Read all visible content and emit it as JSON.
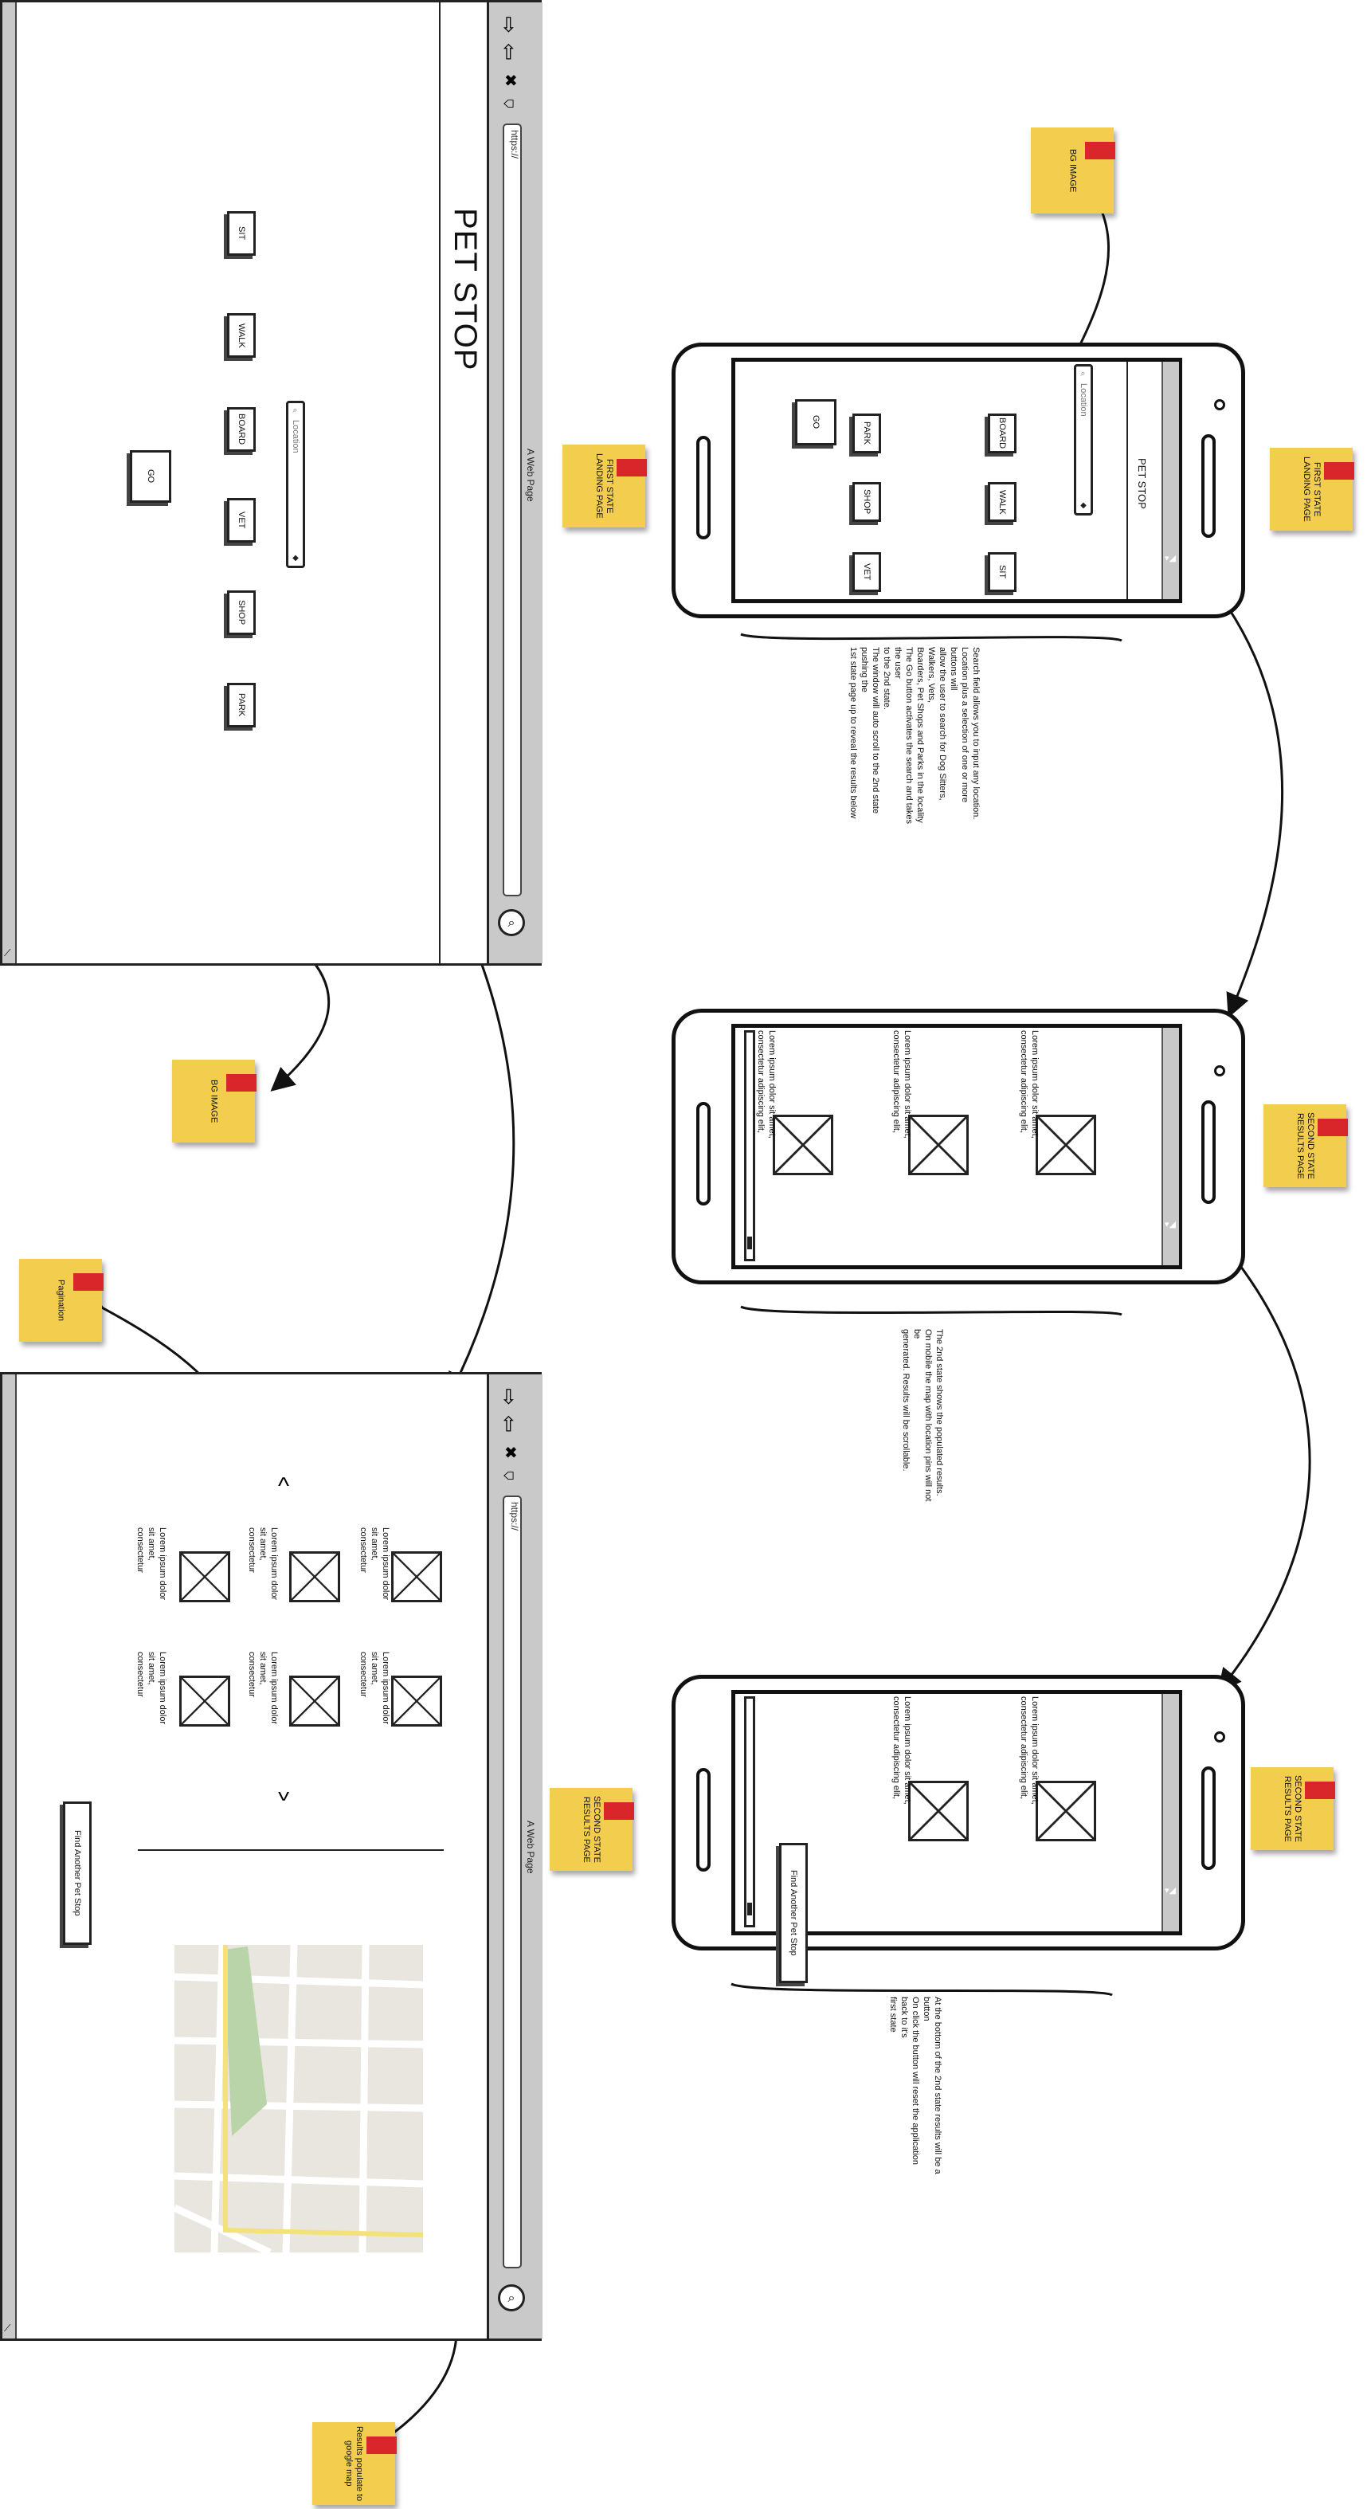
{
  "desktop_landing": {
    "window_title": "A Web Page",
    "url": "https://",
    "app_title": "PET STOP",
    "buttons": [
      "SIT",
      "WALK",
      "BOARD",
      "VET",
      "SHOP",
      "PARK"
    ],
    "search_placeholder": "Location",
    "go_label": "GO"
  },
  "desktop_results": {
    "window_title": "A Web Page",
    "url": "https://",
    "results_col1": [
      "Lorem ipsum dolor sit amet, consectetur",
      "Lorem ipsum dolor sit amet, consectetur",
      "Lorem ipsum dolor sit amet, consectetur"
    ],
    "results_col2": [
      "Lorem ipsum dolor sit amet, consectetur",
      "Lorem ipsum dolor sit amet, consectetur",
      "Lorem ipsum dolor sit amet, consectetur"
    ],
    "find_another_label": "Find Another Pet Stop"
  },
  "phone_landing": {
    "app_title": "PET STOP",
    "search_placeholder": "Location",
    "buttons_row1": [
      "SIT",
      "WALK",
      "BOARD"
    ],
    "buttons_row2": [
      "VET",
      "SHOP",
      "PARK"
    ],
    "go_label": "GO"
  },
  "phone_results": {
    "lorem": [
      "Lorem ipsum dolor sit amet, consectetur adipiscing elit,",
      "Lorem ipsum dolor sit amet, consectetur adipiscing elit,",
      "Lorem ipsum dolor sit amet, consectetur adipiscing elit,"
    ]
  },
  "phone_results_bottom": {
    "lorem": [
      "Lorem ipsum dolor sit amet, consectetur adipiscing elit,",
      "Lorem ipsum dolor sit amet, consectetur adipiscing elit,"
    ],
    "find_another_label": "Find Another Pet Stop"
  },
  "stickies": {
    "bg_image_1": "BG IMAGE",
    "bg_image_2": "BG IMAGE",
    "first_state_desktop": "FIRST STATE LANDING PAGE",
    "first_state_phone": "FIRST STATE LANDING PAGE",
    "second_state_desktop": "SECOND STATE RESULTS PAGE",
    "second_state_phone": "SECOND STATE RESULTS PAGE",
    "second_state_phone_bottom": "SECOND STATE RESULTS PAGE",
    "pagination": "Pagination",
    "results_map": "Results populate to google map"
  },
  "notes": {
    "landing": "Search field allows you to input any location.\nLocation plus a selection of one or more\nbuttons will\nallow the user to search for Dog Sitters,\nWalkers, Vets,\nBoarders, Pet Shops and Parks in the locality\nThe Go button activates the search and takes\nthe user\nto the 2nd state.\nThe window will auto scroll to the 2nd state\npushing the\n1st state page up to reveal the results below",
    "results": "The 2nd state shows the populated results.\nOn mobile the map with location pins will not\nbe\ngenerated. Results will be scrollable.",
    "bottom": "At the bottom of the 2nd state results will be a\nbutton\nOn click the button will reset the application\nback to it's\nfirst state"
  },
  "icons": {
    "back": "back-arrow-icon",
    "forward": "forward-arrow-icon",
    "close": "close-icon",
    "home": "home-icon",
    "search": "search-icon"
  }
}
